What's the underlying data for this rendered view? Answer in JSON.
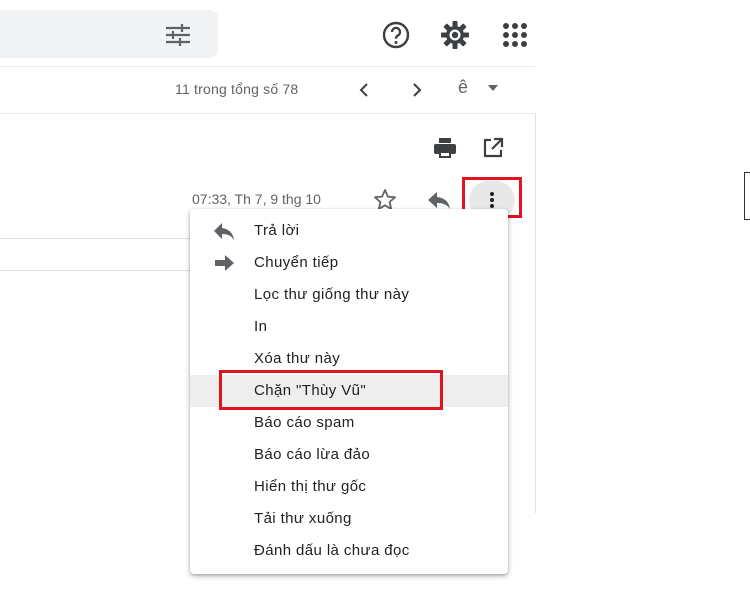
{
  "toolbar": {
    "pager_text": "11 trong tổng số 78",
    "input_tool_glyph": "ê"
  },
  "message": {
    "date": "07:33, Th 7, 9 thg 10"
  },
  "menu": {
    "items": [
      {
        "label": "Trả lời",
        "icon": "reply-icon"
      },
      {
        "label": "Chuyển tiếp",
        "icon": "forward-icon"
      },
      {
        "label": "Lọc thư giống thư này"
      },
      {
        "label": "In"
      },
      {
        "label": "Xóa thư này"
      },
      {
        "label": "Chặn \"Thùy Vũ\"",
        "highlighted": true
      },
      {
        "label": "Báo cáo spam"
      },
      {
        "label": "Báo cáo lừa đảo"
      },
      {
        "label": "Hiển thị thư gốc"
      },
      {
        "label": "Tải thư xuống"
      },
      {
        "label": "Đánh dấu là chưa đọc"
      }
    ]
  },
  "colors": {
    "highlight": "#e0141e",
    "icon": "#5f6368",
    "hover_bg": "#eeeeee"
  }
}
